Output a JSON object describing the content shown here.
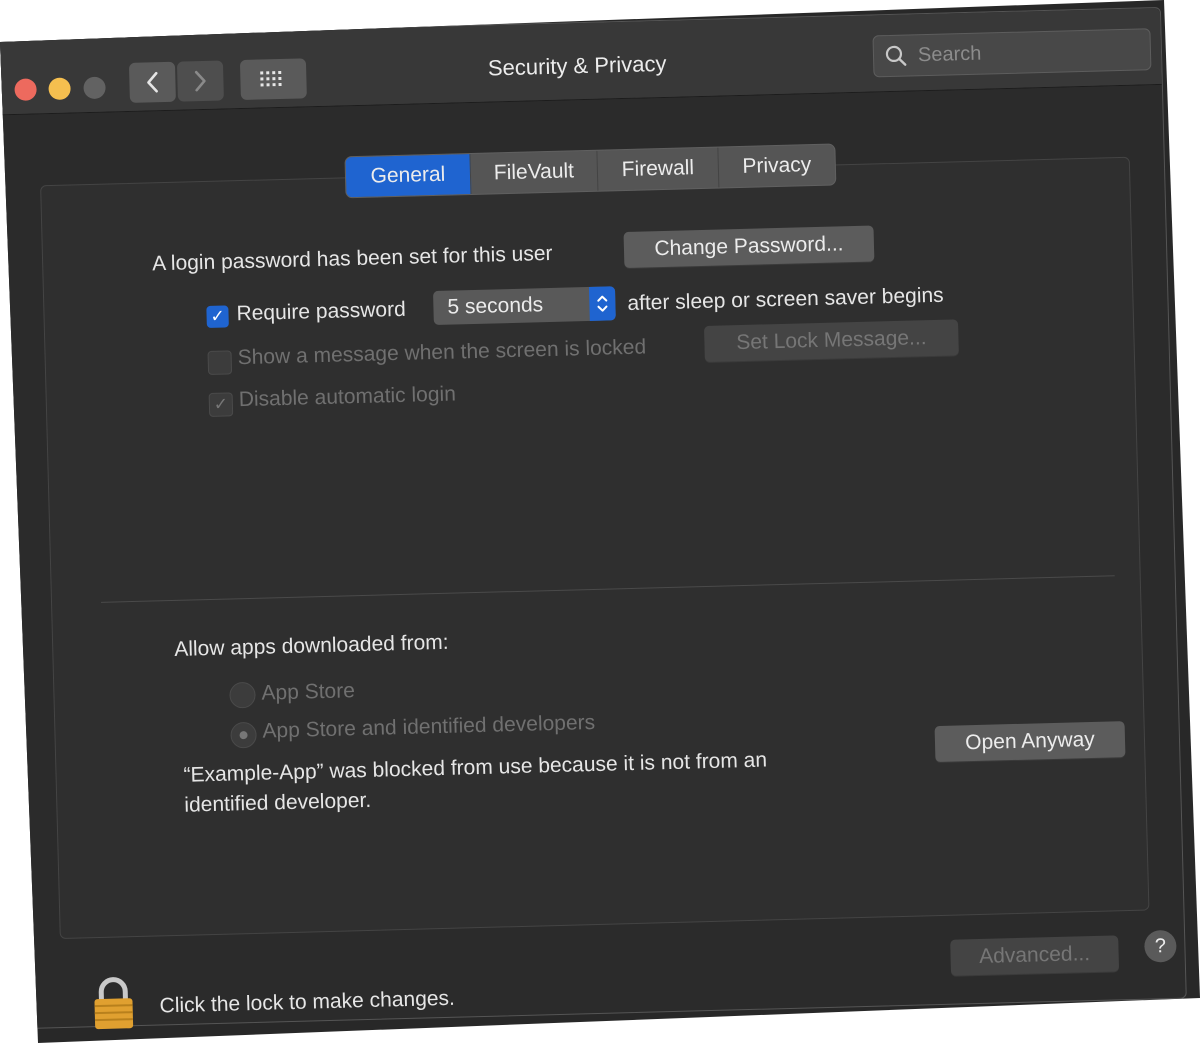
{
  "window": {
    "title": "Security & Privacy",
    "search_placeholder": "Search"
  },
  "tabs": [
    {
      "label": "General",
      "active": true
    },
    {
      "label": "FileVault",
      "active": false
    },
    {
      "label": "Firewall",
      "active": false
    },
    {
      "label": "Privacy",
      "active": false
    }
  ],
  "general": {
    "login_password_text": "A login password has been set for this user",
    "change_password_label": "Change Password...",
    "require_password_label": "Require password",
    "require_password_checked": true,
    "require_password_delay": "5 seconds",
    "after_sleep_text": "after sleep or screen saver begins",
    "show_message_label": "Show a message when the screen is locked",
    "show_message_checked": false,
    "set_lock_message_label": "Set Lock Message...",
    "disable_auto_login_label": "Disable automatic login",
    "disable_auto_login_checked": true
  },
  "downloads": {
    "heading": "Allow apps downloaded from:",
    "options": [
      {
        "label": "App Store",
        "selected": false
      },
      {
        "label": "App Store and identified developers",
        "selected": true
      }
    ],
    "blocked_line1": "“Example-App” was blocked from use because it is not from an",
    "blocked_line2": "identified developer.",
    "open_anyway_label": "Open Anyway"
  },
  "footer": {
    "lock_text": "Click the lock to make changes.",
    "advanced_label": "Advanced...",
    "help_label": "?"
  },
  "colors": {
    "accent": "#1f64d0",
    "window_bg": "#2b2b2b",
    "lock_gold": "#e0a030"
  }
}
